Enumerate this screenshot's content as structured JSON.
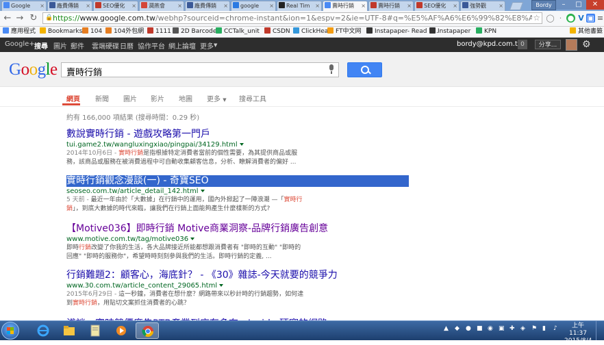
{
  "browser": {
    "tabs": [
      {
        "label": "Google",
        "fav": "g"
      },
      {
        "label": "廠費傳銷",
        "fav": "b"
      },
      {
        "label": "SEO優化",
        "fav": "r"
      },
      {
        "label": "潤燕會",
        "fav": "m"
      },
      {
        "label": "廠費傳銷",
        "fav": "b"
      },
      {
        "label": "google",
        "fav": "c"
      },
      {
        "label": "Real Tim",
        "fav": "k"
      },
      {
        "label": "賣時行銷",
        "fav": "g"
      },
      {
        "label": "賣時行銷",
        "fav": "r"
      },
      {
        "label": "SEO優化",
        "fav": "r"
      },
      {
        "label": "強勢觀",
        "fav": "b"
      }
    ],
    "user_badge": "Bordy",
    "url_scheme": "https://",
    "url_host": "www.google.com.tw",
    "url_path": "/webhp?sourceid=chrome-instant&ion=1&espv=2&ie=UTF-8#q=%E5%AF%A6%E6%99%82%E8%A1%8C%E9%8A%B7"
  },
  "bookmarks": [
    {
      "label": "應用程式",
      "color": "#4a8af4"
    },
    {
      "label": "Bookmarks",
      "color": "#f4b400"
    },
    {
      "label": "104",
      "color": "#e67e22"
    },
    {
      "label": "104外包網",
      "color": "#e67e22"
    },
    {
      "label": "1111",
      "color": "#c0392b"
    },
    {
      "label": "2D Barcodes",
      "color": "#555"
    },
    {
      "label": "CCTalk_unit",
      "color": "#27ae60"
    },
    {
      "label": "CSDN",
      "color": "#c0392b"
    },
    {
      "label": "ClickHeat",
      "color": "#3498db"
    },
    {
      "label": "FT中文网",
      "color": "#f39c12"
    },
    {
      "label": "Instapaper- Read L...",
      "color": "#333"
    },
    {
      "label": "Instapaper",
      "color": "#333"
    },
    {
      "label": "KPN",
      "color": "#27ae60"
    },
    {
      "label": "其他書籤",
      "color": "#f4b400"
    }
  ],
  "gbar": {
    "items": [
      "Google+",
      "搜尋",
      "圖片",
      "郵件",
      "雲端硬碟",
      "日曆",
      "協作平台",
      "網上論壇",
      "更多"
    ],
    "account": "bordy@kpd.com.tw",
    "count": "0",
    "share": "分享..."
  },
  "search": {
    "logo": [
      "G",
      "o",
      "o",
      "g",
      "l",
      "e"
    ],
    "query": "賣時行銷"
  },
  "tabs": [
    "網頁",
    "新聞",
    "圖片",
    "影片",
    "地圖",
    "更多",
    "搜尋工具"
  ],
  "stats": "約有 166,000 項結果 (搜尋時間：0.29 秒)",
  "results": [
    {
      "title": "數說實時行銷 - 遊戲攻略第一門戶",
      "url": "tui.game2.tw/wangluxingxiao/pingpai/34129.html",
      "date": "2014年10月6日 -",
      "hl": "實時行銷",
      "snippet": "是指根據特定消費者當前的個性需要，為其提供商品或服務，該商品或服務在被消費過程中可自動收集顧客信息，分析、瞭解消費者的偏好 ..."
    },
    {
      "title": "實時行銷觀念漫談(一) - 奇寶SEO",
      "url": "seoseo.com.tw/article_detail_142.html",
      "date": "5 天前 -",
      "pre": "最近一年由於「大數據」在行銷中的運用，國內外掀起了一陣浪潮 —「",
      "hl": "實時行銷",
      "snippet": "」，到底大數據的時代來臨，讓我們在行銷上面能夠產生什麼樣新的方式?"
    },
    {
      "title": "【Motive036】即時行銷 Motive商業洞察-品牌行銷廣告創意",
      "url": "www.motive.com.tw/tag/motive036",
      "date": "",
      "pre": "即時",
      "hl": "行銷",
      "snippet": "改變了你我的生活，各大品牌接近所能都想跟消費者有 \"即時的互動\" \"即時的回應\" \"即時的服務你\"，希望時時刻刻參與我們的生活。即時行銷的定義, ..."
    },
    {
      "title": "行銷難題2：顧客心，海底針？ - 《30》雜誌-今天就要的競爭力",
      "url": "www.30.com.tw/article_content_29065.html",
      "date": "2015年6月29日 -",
      "pre": "這一秒鐘，消費者在想什麼？網路帶來以秒計時的行銷趨勢，如何達到",
      "hl": "實時行銷",
      "snippet": "，用貼切文案抓住消費者的心跳？"
    }
  ],
  "bottom_cut": "淺談：實時競價廣告RTB產業到底有多夯 - Inside 硬塞的網路",
  "taskbar": {
    "clock_time": "上午 11:37",
    "clock_date": "2015/8/4"
  }
}
